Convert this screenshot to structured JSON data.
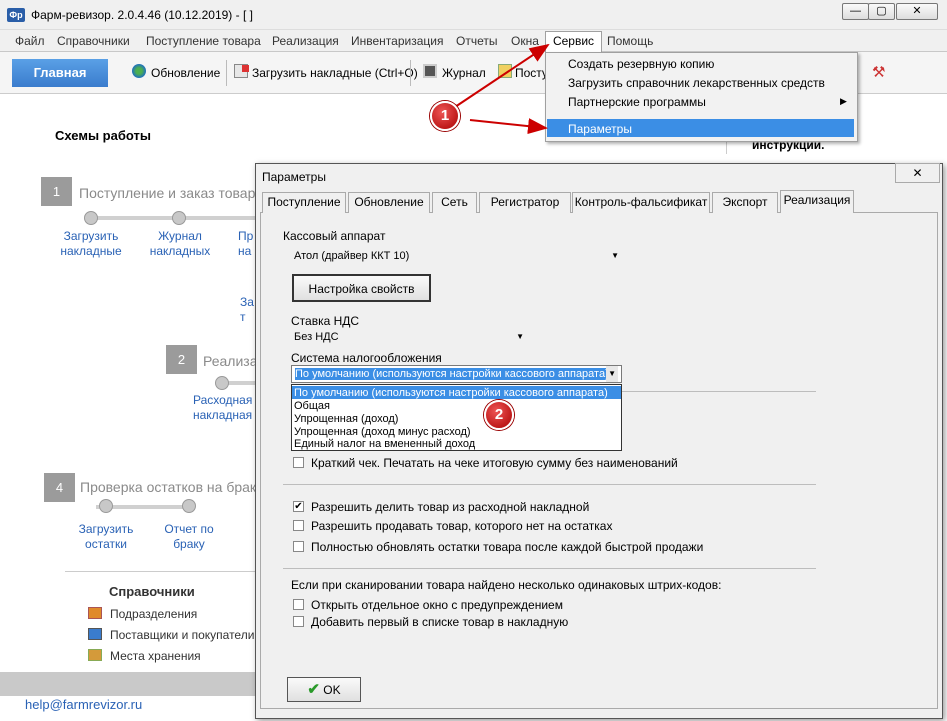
{
  "window": {
    "title": "Фарм-ревизор. 2.0.4.46 (10.12.2019) - [ ]",
    "app_icon": "Фр",
    "min": "—",
    "max": "▢",
    "close": "✕"
  },
  "menu": [
    "Файл",
    "Справочники",
    "Поступление товара",
    "Реализация",
    "Инвентаризация",
    "Отчеты",
    "Окна",
    "Сервис",
    "Помощь"
  ],
  "toolbar": {
    "main": "Главная",
    "update": "Обновление",
    "load": "Загрузить накладные (Ctrl+O)",
    "journal": "Журнал",
    "post": "Посту"
  },
  "panel": {
    "title": "Схемы работы",
    "step1": {
      "num": "1",
      "title": "Поступление и заказ товара",
      "l1a": "Загрузить",
      "l1b": "накладные",
      "l2a": "Журнал",
      "l2b": "накладных",
      "l3a": "Пр",
      "l3b": "на",
      "l4a": "За",
      "l4b": "т"
    },
    "step2": {
      "num": "2",
      "title": "Реализа",
      "l1a": "Расходная",
      "l1b": "накладная"
    },
    "step4": {
      "num": "4",
      "title": "Проверка остатков на брак",
      "l1a": "Загрузить",
      "l1b": "остатки",
      "l2a": "Отчет по",
      "l2b": "браку"
    },
    "ref_title": "Справочники",
    "refs": [
      "Подразделения",
      "Поставщики и покупатели",
      "Места хранения"
    ],
    "email": "help@farmrevizor.ru",
    "right_text": "инструкции."
  },
  "service_menu": [
    "Создать резервную копию",
    "Загрузить справочник лекарственных средств",
    "Партнерские программы",
    "Параметры"
  ],
  "badges": [
    "1",
    "2"
  ],
  "dialog": {
    "title": "Параметры",
    "tabs": [
      "Поступление",
      "Обновление",
      "Сеть",
      "Регистратор",
      "Контроль-фальсификат",
      "Экспорт",
      "Реализация"
    ],
    "cash_label": "Кассовый аппарат",
    "cash_value": "Атол (драйвер ККТ 10)",
    "settings_btn": "Настройка свойств",
    "vat_label": "Ставка НДС",
    "vat_value": "Без НДС",
    "tax_label": "Система налогообложения",
    "tax_value": "По умолчанию (используются настройки кассового аппарата)",
    "tax_options": [
      "По умолчанию (используются настройки кассового аппарата)",
      "Общая",
      "Упрощенная (доход)",
      "Упрощенная (доход минус расход)",
      "Единый налог на вмененный доход"
    ],
    "short_check": "Краткий чек. Печатать на чеке итоговую сумму без наименований",
    "opt_split": "Разрешить делить товар из расходной накладной",
    "opt_sell_missing": "Разрешить продавать товар, которого нет на остатках",
    "opt_refresh": "Полностью обновлять остатки товара после каждой быстрой продажи",
    "barcode_label": "Если при сканировании товара найдено несколько одинаковых штрих-кодов:",
    "opt_window": "Открыть отдельное окно с предупреждением",
    "opt_first": "Добавить первый в списке товар в накладную",
    "ok": "OK",
    "close": "✕"
  },
  "checked": {
    "short_check": false,
    "opt_split": true,
    "opt_sell_missing": false,
    "opt_refresh": false,
    "opt_window": false,
    "opt_first": false
  }
}
